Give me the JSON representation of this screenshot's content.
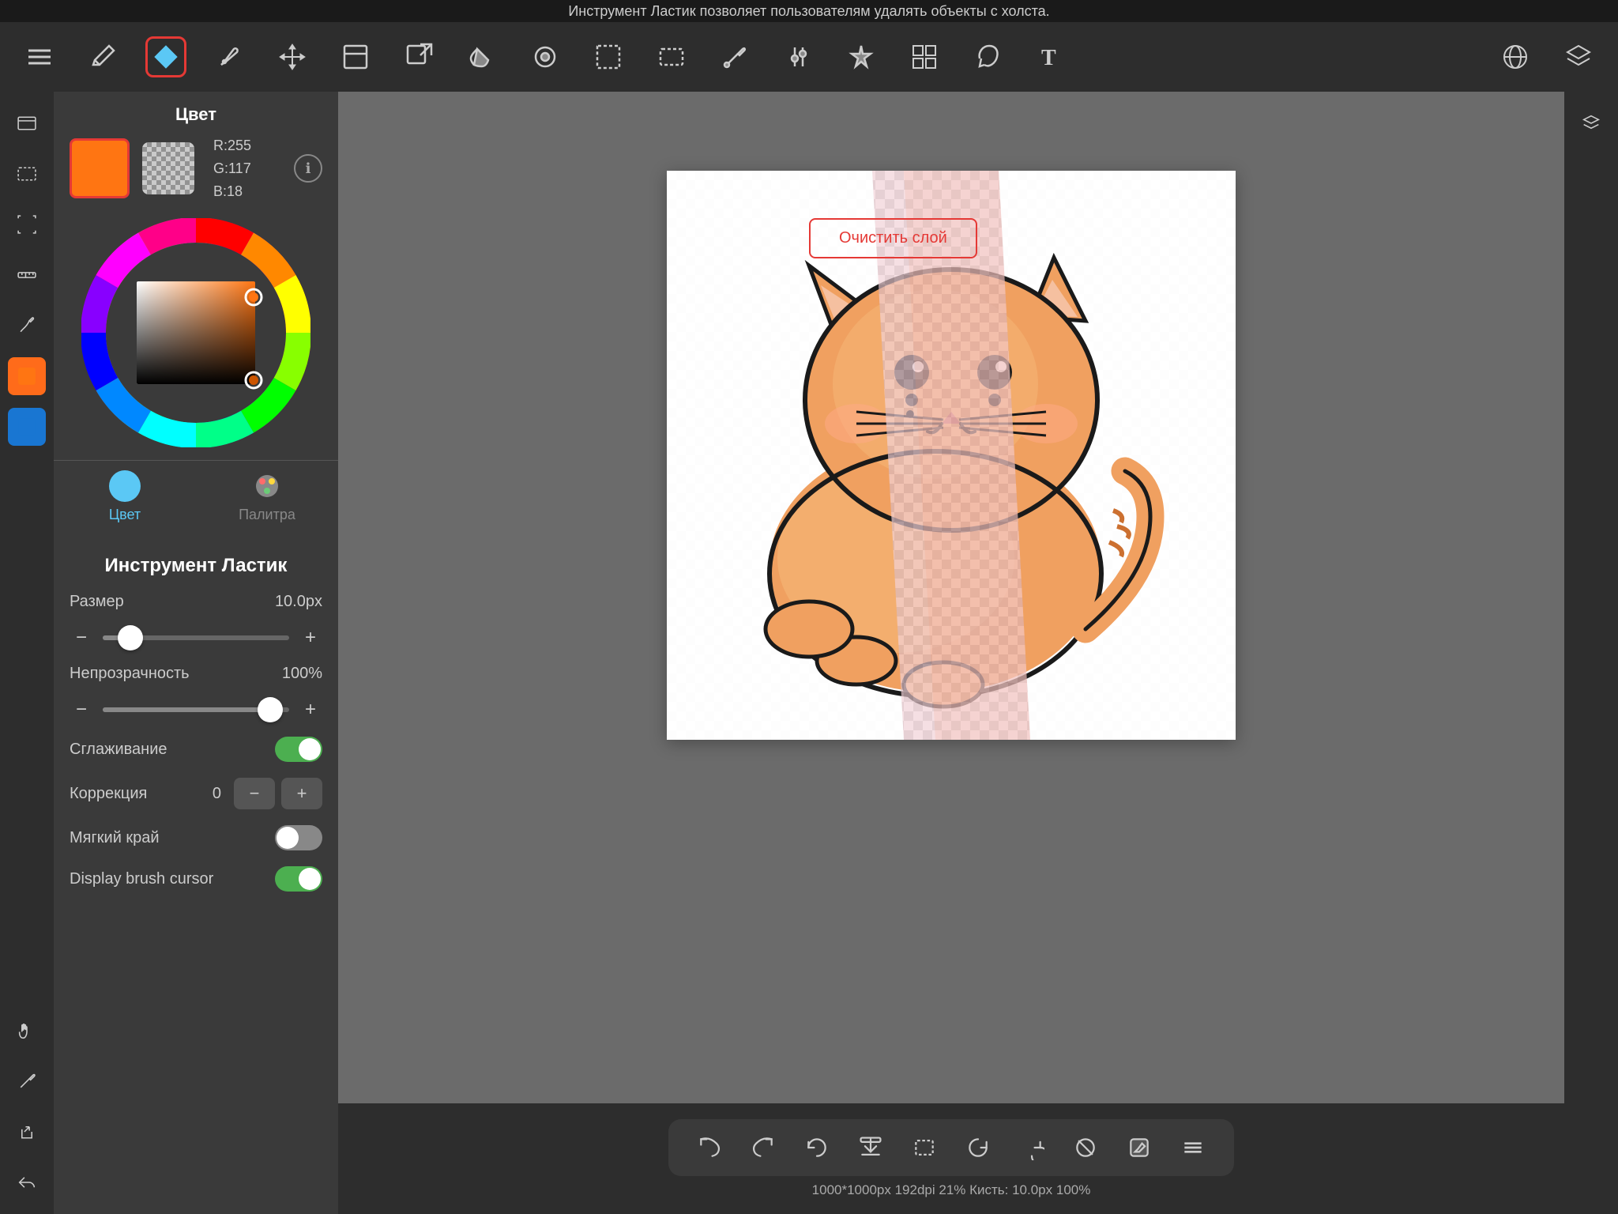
{
  "topbar": {
    "text": "Инструмент Ластик позволяет пользователям удалять объекты с холста."
  },
  "toolbar": {
    "tools": [
      {
        "name": "menu-icon",
        "symbol": "☰"
      },
      {
        "name": "pencil-icon",
        "symbol": "✏️"
      },
      {
        "name": "eraser-icon",
        "symbol": "◆",
        "active": true
      },
      {
        "name": "pen-icon",
        "symbol": "✒️"
      },
      {
        "name": "move-icon",
        "symbol": "✛"
      },
      {
        "name": "transform-icon",
        "symbol": "⬜"
      },
      {
        "name": "export-icon",
        "symbol": "↗"
      },
      {
        "name": "fill-icon",
        "symbol": "🪣"
      },
      {
        "name": "paint-icon",
        "symbol": "🎨"
      },
      {
        "name": "rect-icon",
        "symbol": "▭"
      },
      {
        "name": "select-icon",
        "symbol": "⬚"
      },
      {
        "name": "eyedropper-icon",
        "symbol": "💉"
      },
      {
        "name": "adjust-icon",
        "symbol": "🎚"
      },
      {
        "name": "magic-icon",
        "symbol": "💎"
      },
      {
        "name": "layers2-icon",
        "symbol": "⊞"
      },
      {
        "name": "lasso-icon",
        "symbol": "⤴"
      },
      {
        "name": "text-icon",
        "symbol": "T"
      }
    ],
    "right_tools": [
      {
        "name": "globe-icon",
        "symbol": "🌐"
      },
      {
        "name": "layers-icon",
        "symbol": "⧉"
      }
    ]
  },
  "color_panel": {
    "title": "Цвет",
    "primary_color": "#ff7512",
    "secondary_color": "transparent",
    "rgb": {
      "r": "R:255",
      "g": "G:117",
      "b": "B:18"
    },
    "tabs": [
      {
        "id": "color",
        "label": "Цвет",
        "active": true
      },
      {
        "id": "palette",
        "label": "Палитра",
        "active": false
      }
    ]
  },
  "eraser_tool": {
    "title": "Инструмент Ластик",
    "size_label": "Размер",
    "size_value": "10.0px",
    "size_percent": 15,
    "opacity_label": "Непрозрачность",
    "opacity_value": "100%",
    "opacity_percent": 90,
    "smoothing_label": "Сглаживание",
    "smoothing_on": true,
    "correction_label": "Коррекция",
    "correction_value": "0",
    "soft_edge_label": "Мягкий край",
    "soft_edge_on": false,
    "display_cursor_label": "Display brush cursor",
    "display_cursor_on": true
  },
  "canvas": {
    "clear_button": "Очистить слой",
    "status": "1000*1000px 192dpi 21% Кисть: 10.0px 100%"
  },
  "bottom_tools": [
    {
      "name": "undo-icon",
      "symbol": "↩"
    },
    {
      "name": "redo-icon",
      "symbol": "↪"
    },
    {
      "name": "rotate-ccw-icon",
      "symbol": "↺"
    },
    {
      "name": "download-icon",
      "symbol": "⬇"
    },
    {
      "name": "rect-select-icon",
      "symbol": "▭"
    },
    {
      "name": "reset-icon",
      "symbol": "↺"
    },
    {
      "name": "rotate-cw-icon",
      "symbol": "↻"
    },
    {
      "name": "crop-icon",
      "symbol": "⊘"
    },
    {
      "name": "edit-icon",
      "symbol": "✎"
    },
    {
      "name": "menu-dots-icon",
      "symbol": "≡"
    }
  ],
  "left_sidebar": [
    {
      "name": "layers-icon",
      "symbol": "⬚"
    },
    {
      "name": "selection-icon",
      "symbol": "⬚"
    },
    {
      "name": "transform2-icon",
      "symbol": "⤡"
    },
    {
      "name": "ruler-icon",
      "symbol": "📏"
    },
    {
      "name": "brush-icon",
      "symbol": "🖌"
    },
    {
      "name": "layer-orange-icon",
      "symbol": "▪",
      "active": true
    },
    {
      "name": "layer-blue-icon",
      "symbol": "▪",
      "active_blue": true
    },
    {
      "name": "hand-icon",
      "symbol": "✋"
    },
    {
      "name": "dropper-icon",
      "symbol": "💧"
    },
    {
      "name": "share-icon",
      "symbol": "↗"
    },
    {
      "name": "back-icon",
      "symbol": "↩"
    }
  ],
  "right_sidebar": [
    {
      "name": "layers-right-icon",
      "symbol": "⧉"
    }
  ]
}
